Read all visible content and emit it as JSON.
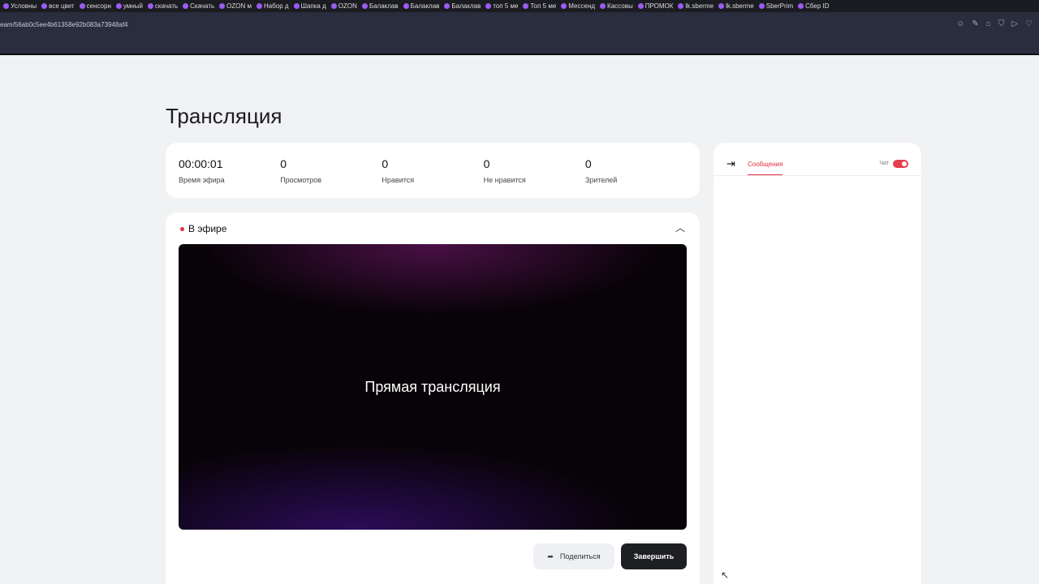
{
  "browser": {
    "bookmarks": [
      "Условны",
      "все цвет",
      "сенсорн",
      "умный",
      "скачать",
      "Скачать",
      "OZON м",
      "Набор д",
      "Шапка д",
      "OZON",
      "Балаклав",
      "Балаклав",
      "Балаклав",
      "топ 5 ме",
      "Топ 5 ме",
      "Мессенд",
      "Кассовы",
      "ПРОМОК",
      "lk.sberme",
      "lk.sberme",
      "SberPrim",
      "Сбер ID"
    ],
    "url": "eam/56ab0c5ee4b61358e92b083a73948af4"
  },
  "page": {
    "title": "Трансляция"
  },
  "stats": [
    {
      "value": "00:00:01",
      "label": "Время эфира"
    },
    {
      "value": "0",
      "label": "Просмотров"
    },
    {
      "value": "0",
      "label": "Нравится"
    },
    {
      "value": "0",
      "label": "Не нравится"
    },
    {
      "value": "0",
      "label": "Зрителей"
    }
  ],
  "live": {
    "status": "В эфире",
    "video_text": "Прямая трансляция",
    "share": "Поделиться",
    "end": "Завершить"
  },
  "chat": {
    "tab": "Сообщения",
    "toggle_label": "Чат",
    "toggle_on": true,
    "accent": "#e0313f"
  }
}
